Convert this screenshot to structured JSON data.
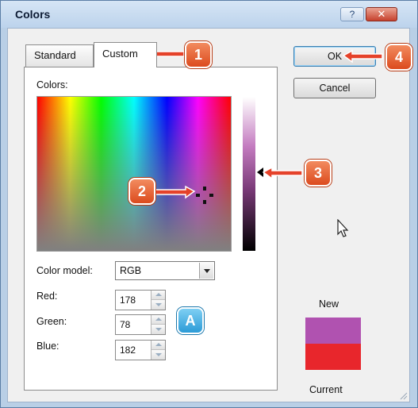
{
  "window": {
    "title": "Colors",
    "help_label": "?",
    "close_label": "✕"
  },
  "tabs": [
    {
      "label": "Standard"
    },
    {
      "label": "Custom"
    }
  ],
  "custom": {
    "colors_label": "Colors:",
    "color_model_label": "Color model:",
    "color_model_value": "RGB",
    "red_label": "Red:",
    "red_value": "178",
    "green_label": "Green:",
    "green_value": "78",
    "blue_label": "Blue:",
    "blue_value": "182"
  },
  "buttons": {
    "ok": "OK",
    "cancel": "Cancel"
  },
  "preview": {
    "new_label": "New",
    "current_label": "Current",
    "new_color": "#b052b0",
    "current_color": "#e8262c"
  },
  "callouts": {
    "one": "1",
    "two": "2",
    "three": "3",
    "four": "4",
    "a": "A"
  },
  "colors": {
    "callout_orange": "#e85a2a",
    "callout_blue": "#2c9bd7"
  }
}
